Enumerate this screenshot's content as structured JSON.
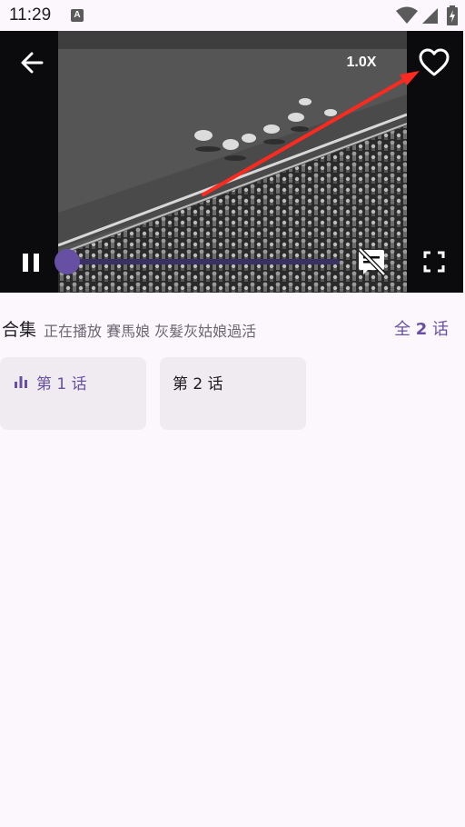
{
  "status_bar": {
    "time": "11:29",
    "notification_letter": "A",
    "icons": [
      "wifi-icon",
      "signal-icon",
      "battery-icon"
    ]
  },
  "player": {
    "speed_label": "1.0X",
    "progress": 0.0,
    "icons": [
      "back-arrow-icon",
      "heart-outline-icon",
      "pause-icon",
      "subtitles-off-icon",
      "fullscreen-icon"
    ],
    "annotation_arrow_color": "#ff2a1f"
  },
  "collection": {
    "title": "合集",
    "now_playing": "正在播放 賽馬娘 灰髮灰姑娘過活",
    "total_prefix": "全",
    "total_count": "2",
    "total_suffix": "话",
    "episodes": [
      {
        "label": "第 1 话",
        "active": true
      },
      {
        "label": "第 2 话",
        "active": false
      }
    ]
  },
  "colors": {
    "accent": "#6750a4",
    "background": "#fcf7fd",
    "card": "#f0ebf1"
  }
}
